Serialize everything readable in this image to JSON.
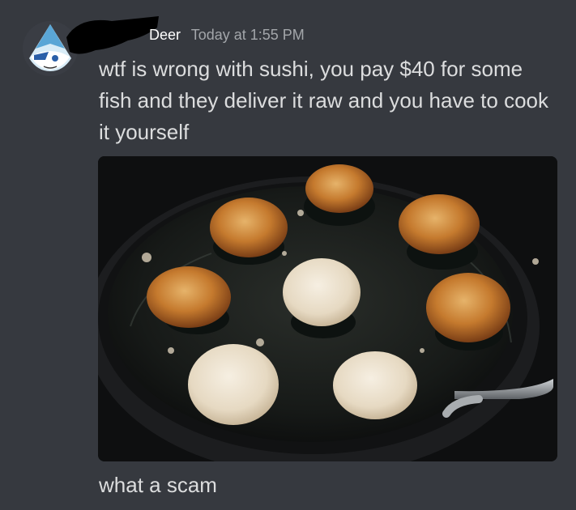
{
  "message": {
    "username": "Deer",
    "timestamp": "Today at 1:55 PM",
    "text": "wtf is wrong with sushi, you pay $40 for some fish and they deliver it raw and you have to cook it yourself",
    "attachment_icon": "photo-of-sushi-frying-in-pan",
    "followup_text": "what a scam"
  },
  "colors": {
    "background": "#36393f",
    "text": "#dcddde",
    "timestamp": "#a3a6aa"
  }
}
